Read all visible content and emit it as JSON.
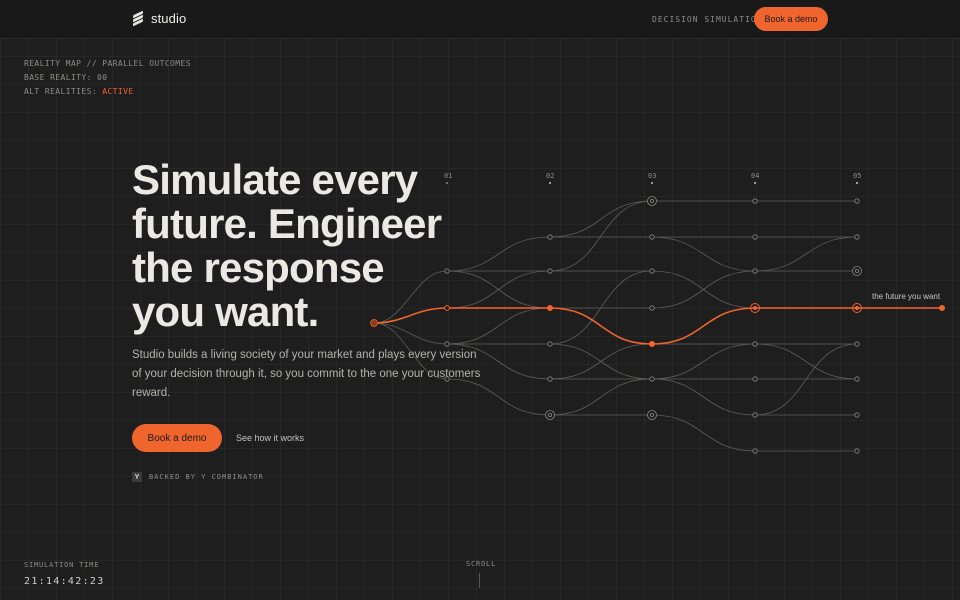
{
  "header": {
    "logo_text": "studio",
    "nav_link": "DECISION SIMULATION",
    "cta": "Book a demo"
  },
  "status": {
    "line1": "REALITY MAP // PARALLEL OUTCOMES",
    "line2_label": "BASE REALITY:",
    "line2_value": "00",
    "line3_label": "ALT REALITIES:",
    "line3_value": "ACTIVE"
  },
  "hero": {
    "title": "Simulate every future. Engineer the response you want.",
    "subtitle": "Studio builds a living society of your market and plays every version of your decision through it, so you commit to the one your customers reward.",
    "primary_cta": "Book a demo",
    "secondary_link": "See how it works",
    "badge_letter": "Y",
    "backed_by": "BACKED BY Y COMBINATOR"
  },
  "reality_map": {
    "columns": [
      "01",
      "02",
      "03",
      "04",
      "05"
    ],
    "highlight_label": "the future you want",
    "accent": "#f0642e"
  },
  "footer": {
    "sim_label": "SIMULATION TIME",
    "sim_time": "21:14:42:23",
    "scroll_label": "SCROLL"
  },
  "colors": {
    "background": "#1e1e1e",
    "accent": "#f0642e",
    "text": "#ebe9e4",
    "muted": "#8e8c87"
  }
}
